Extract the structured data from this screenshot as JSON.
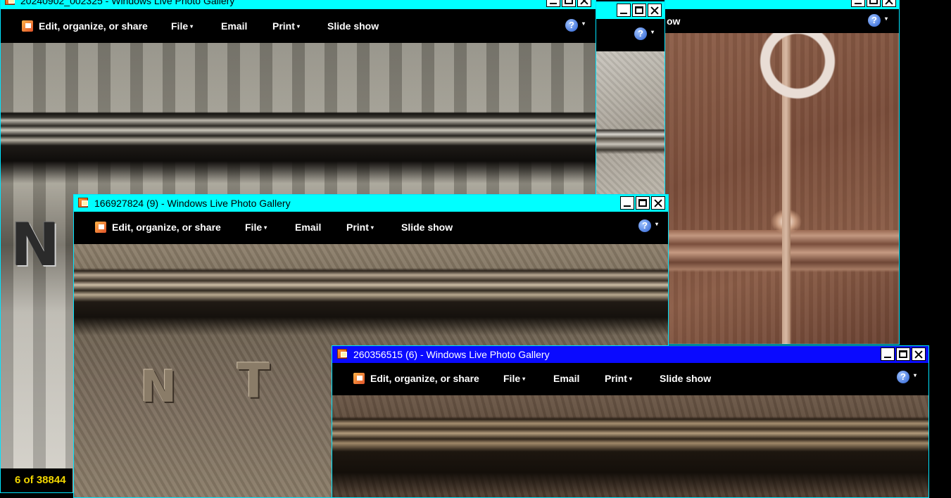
{
  "windows": {
    "w1": {
      "title": "20240902_002325 - Windows Live Photo Gallery"
    },
    "w2": {
      "title": ""
    },
    "w3": {
      "title": ""
    },
    "w4": {
      "title": "166927824 (9) - Windows Live Photo Gallery"
    },
    "w5": {
      "title": "260356515 (6) - Windows Live Photo Gallery"
    }
  },
  "toolbar": {
    "edit_label": "Edit, organize, or share",
    "file_label": "File",
    "email_label": "Email",
    "print_label": "Print",
    "slideshow_label": "Slide show",
    "partial_slideshow_label": "ow",
    "help_glyph": "?",
    "caret_glyph": "▾"
  },
  "coin_letters": {
    "left_n": "N",
    "front_n": "N",
    "front_t": "T"
  },
  "status": {
    "counter": "6 of 38844"
  },
  "colors": {
    "titlebar_inactive": "#00ffff",
    "titlebar_active": "#0a0aff",
    "counter_text": "#f2d600"
  }
}
